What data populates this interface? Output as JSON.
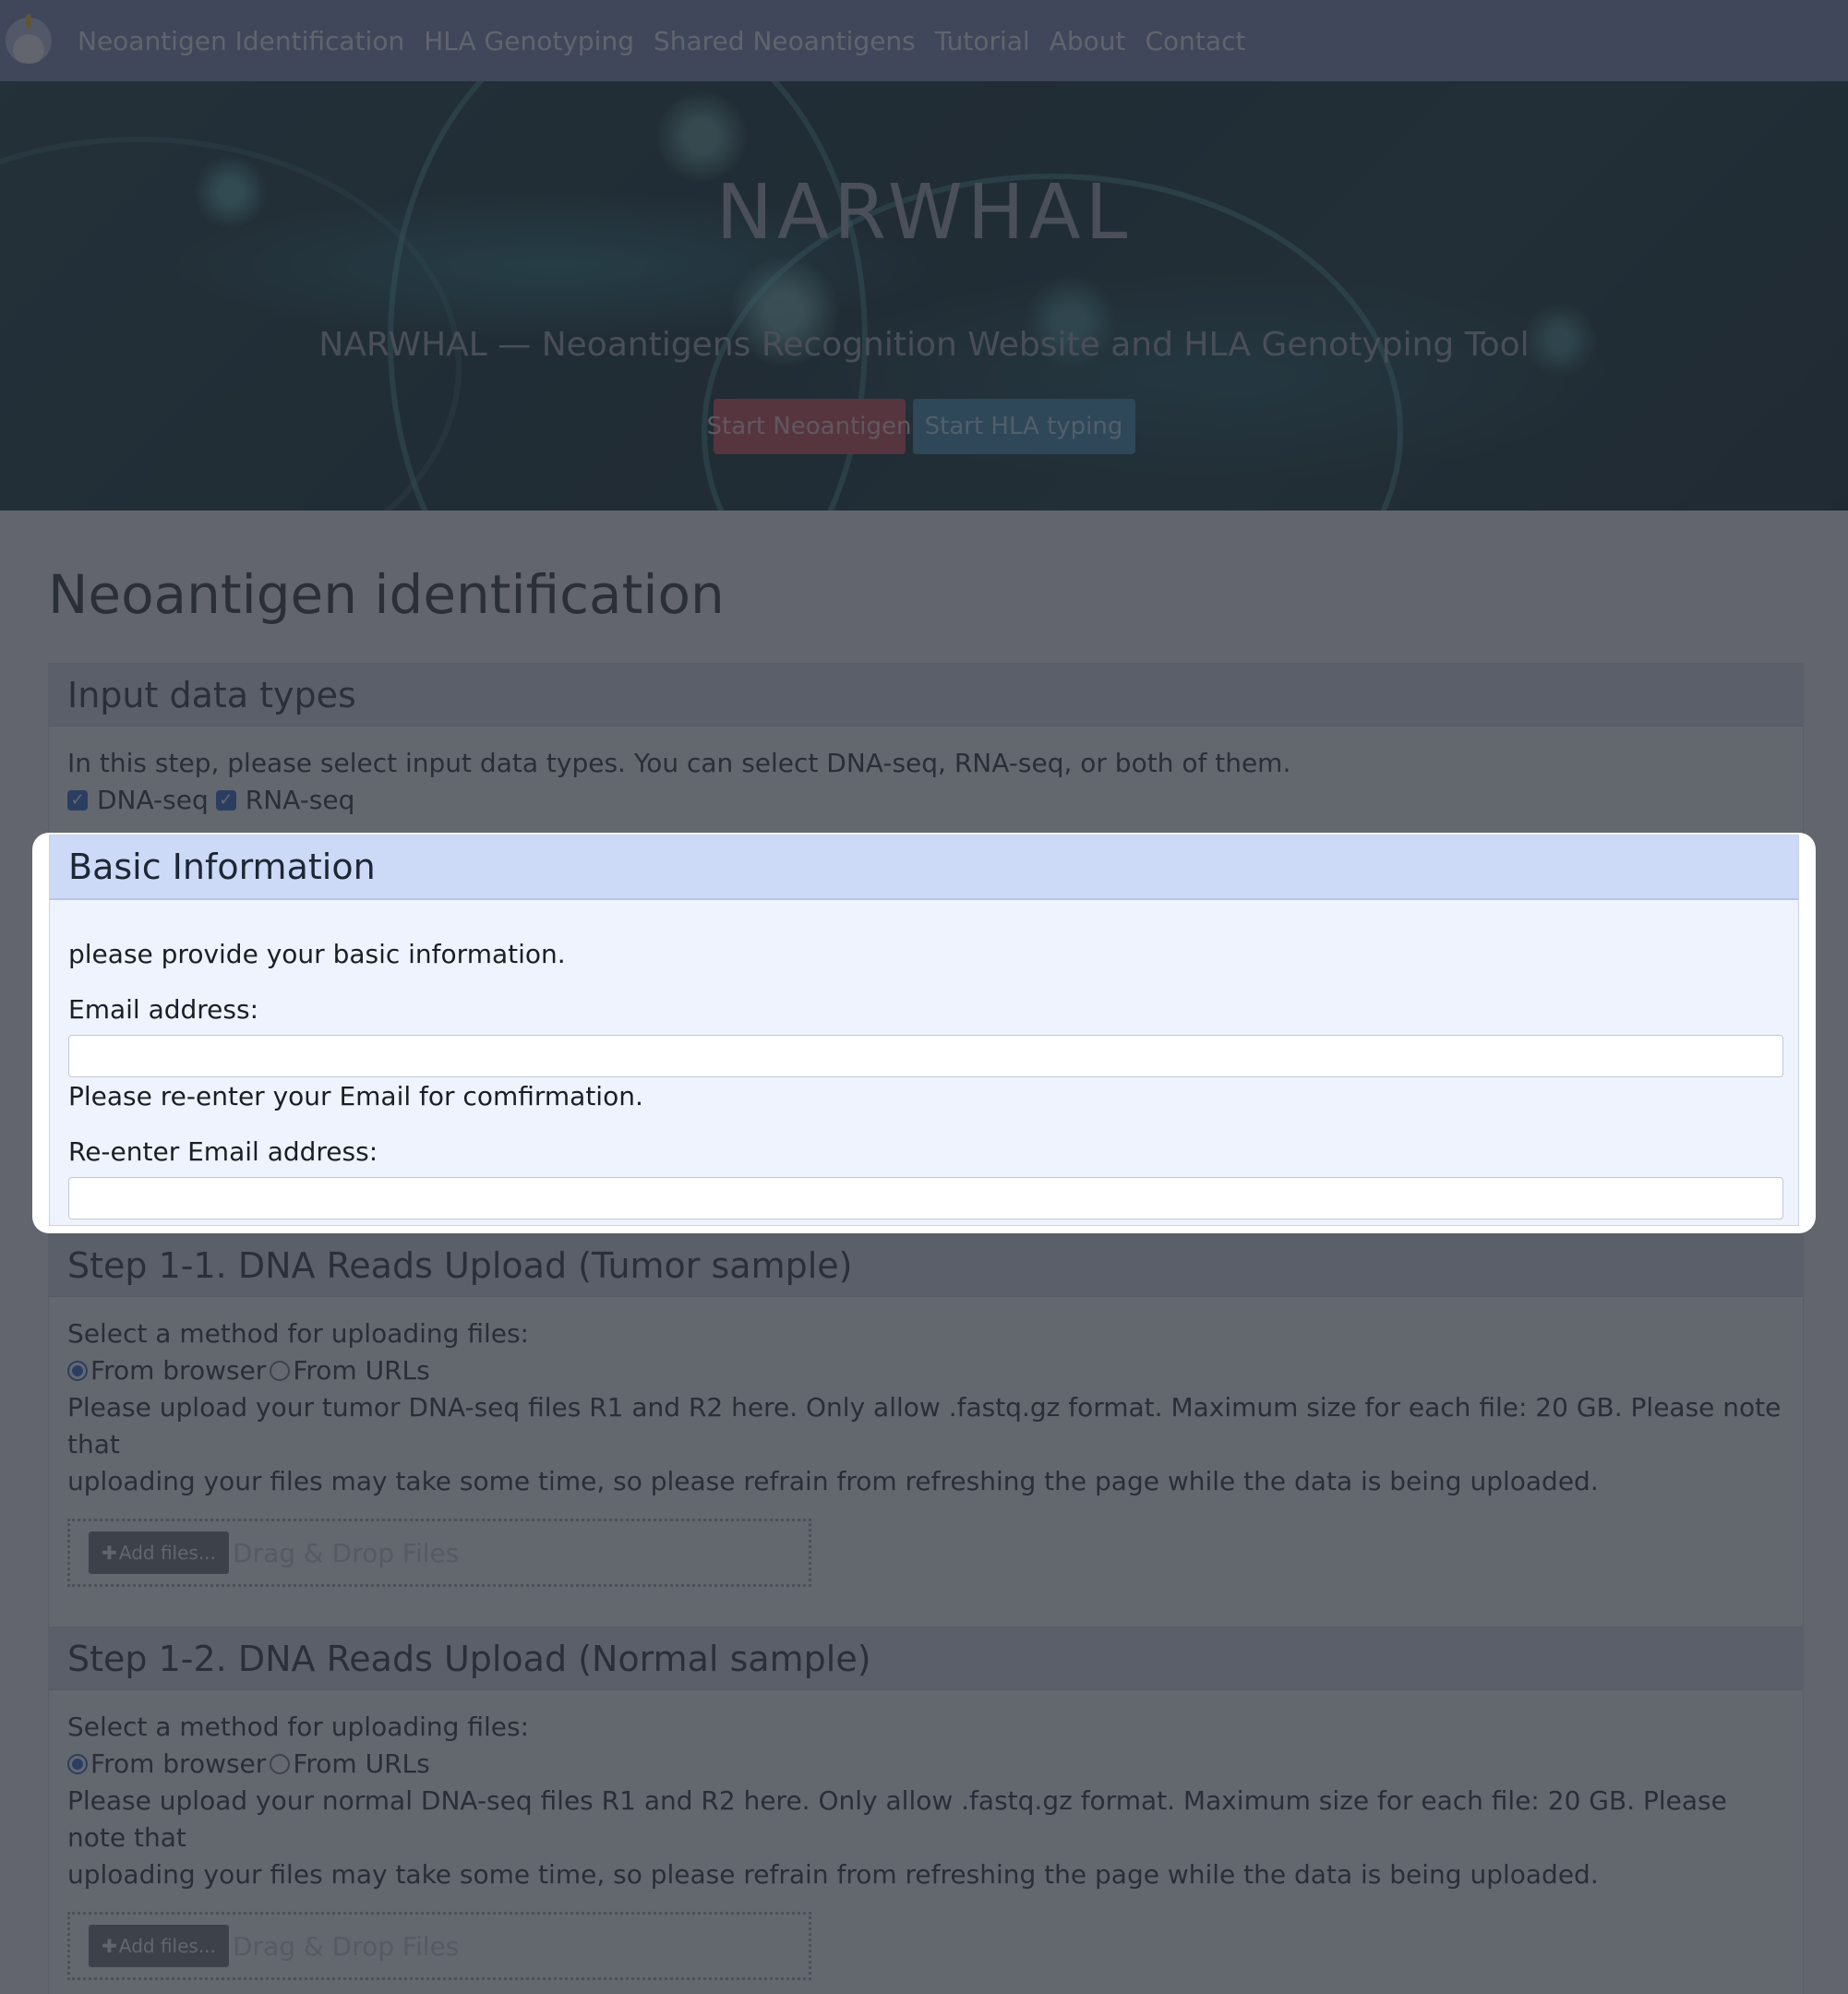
{
  "nav": {
    "items": [
      "Neoantigen Identification",
      "HLA Genotyping",
      "Shared Neoantigens",
      "Tutorial",
      "About",
      "Contact"
    ]
  },
  "hero": {
    "title": "NARWHAL",
    "subtitle": "NARWHAL — Neoantigens Recognition Website and HLA Genotyping Tool",
    "btn_neoantigen": "Start Neoantigen",
    "btn_hla": "Start HLA typing"
  },
  "main": {
    "heading": "Neoantigen identification",
    "input_types": {
      "title": "Input data types",
      "desc": "In this step, please select input data types. You can select DNA-seq, RNA-seq, or both of them.",
      "dna_label": "DNA-seq",
      "rna_label": "RNA-seq",
      "dna_checked": true,
      "rna_checked": true
    },
    "basic": {
      "title": "Basic Information",
      "desc": "please provide your basic information.",
      "email_label": "Email address:",
      "email_value": "",
      "confirm_desc": "Please re-enter your Email for comfirmation.",
      "reemail_label": "Re-enter Email address:",
      "reemail_value": ""
    },
    "step11": {
      "title": "Step 1-1. DNA Reads Upload (Tumor sample)",
      "method_label": "Select a method for uploading files:",
      "opt_browser": "From browser",
      "opt_urls": "From URLs",
      "selected": "From browser",
      "desc_line1": "Please upload your tumor DNA-seq files R1 and R2 here. Only allow .fastq.gz format. Maximum size for each file: 20 GB. Please note that",
      "desc_line2": "uploading your files may take some time, so please refrain from refreshing the page while the data is being uploaded.",
      "add_files": "Add files...",
      "drop_text": "Drag & Drop Files"
    },
    "step12": {
      "title": "Step 1-2. DNA Reads Upload (Normal sample)",
      "method_label": "Select a method for uploading files:",
      "opt_browser": "From browser",
      "opt_urls": "From URLs",
      "selected": "From browser",
      "desc_line1": "Please upload your normal DNA-seq files R1 and R2 here. Only allow .fastq.gz format. Maximum size for each file: 20 GB. Please note that",
      "desc_line2": "uploading your files may take some time, so please refrain from refreshing the page while the data is being uploaded.",
      "add_files": "Add files...",
      "drop_text": "Drag & Drop Files"
    }
  },
  "icons": {
    "logo": "narwhal-logo",
    "checkbox": "checkmark-icon",
    "add": "plus-icon"
  },
  "colors": {
    "navbar": "#7b8ab3",
    "btn_red": "#c94a4f",
    "btn_blue": "#3c8cb3",
    "highlight_head": "#ccdaf7"
  }
}
